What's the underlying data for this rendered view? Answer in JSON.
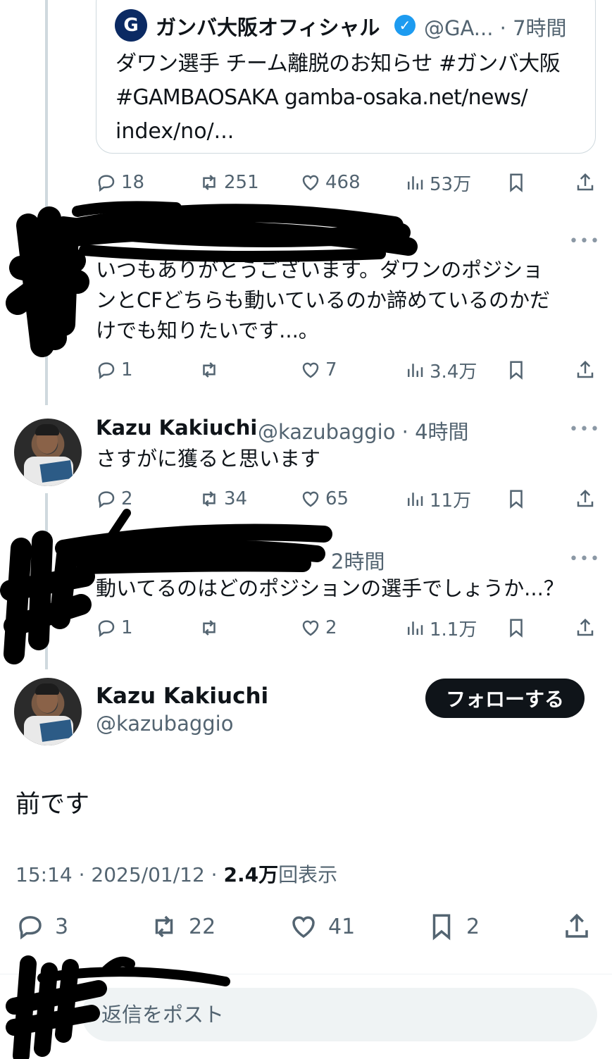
{
  "quoted": {
    "avatar_letter": "G",
    "name": "ガンバ大阪オフィシャル",
    "handle_time": "@GA... · 7時間",
    "lines": [
      "ダワン選手 チーム離脱のお知らせ #ガンバ大阪",
      "#GAMBAOSAKA gamba-osaka.net/news/",
      "index/no/..."
    ]
  },
  "stats": {
    "top": {
      "replies": "18",
      "reposts": "251",
      "likes": "468",
      "views": "53万"
    },
    "r1": {
      "replies": "1",
      "reposts": "",
      "likes": "7",
      "views": "3.4万"
    },
    "r2": {
      "replies": "2",
      "reposts": "34",
      "likes": "65",
      "views": "11万"
    },
    "r3": {
      "replies": "1",
      "reposts": "",
      "likes": "2",
      "views": "1.1万"
    }
  },
  "reply1": {
    "lines": [
      "いつもありがとうございます。ダワンのポジショ",
      "ンとCFどちらも動いているのか諦めているのかだ",
      "けでも知りたいです...。"
    ]
  },
  "reply2": {
    "name": "Kazu Kakiuchi",
    "handle_time": "@kazubaggio · 4時間",
    "text": "さすがに獲ると思います"
  },
  "reply3": {
    "time": "2時間",
    "text": "動いてるのはどのポジションの選手でしょうか...？"
  },
  "main": {
    "name": "Kazu Kakiuchi",
    "handle": "@kazubaggio",
    "follow_label": "フォローする",
    "text": "前です",
    "meta_time": "15:14 · 2025/01/12 · ",
    "meta_views": "2.4万",
    "meta_views_suffix": "回表示",
    "replies": "3",
    "reposts": "22",
    "likes": "41",
    "bookmarks": "2"
  },
  "reply_placeholder": "返信をポスト",
  "more_label": "•••",
  "colors": {
    "text": "#0f1419",
    "secondary": "#536471",
    "verified": "#1d9bf0",
    "line": "#cfd9de"
  }
}
